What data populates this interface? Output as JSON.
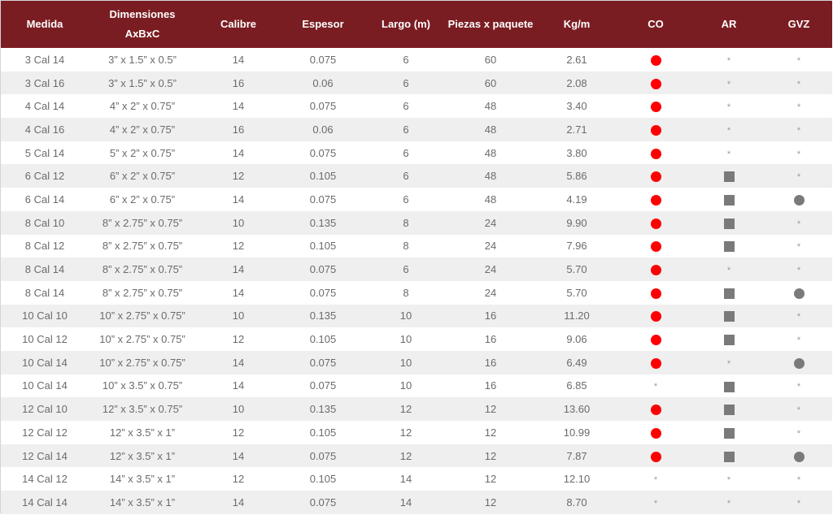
{
  "header": {
    "medida": "Medida",
    "dimensiones_1": "Dimensiones",
    "dimensiones_2": "AxBxC",
    "calibre": "Calibre",
    "espesor": "Espesor",
    "largo": "Largo (m)",
    "piezas": "Piezas x paquete",
    "kgm": "Kg/m",
    "co": "CO",
    "ar": "AR",
    "gvz": "GVZ"
  },
  "colors": {
    "header_bg": "#7a1d22",
    "co_marker": "#ff0000",
    "marker_gray": "#7a7a7a"
  },
  "marker_legend": {
    "circle-red": "red dot",
    "circle-gray": "gray dot",
    "square-gray": "gray square",
    "asterisk": "*"
  },
  "rows": [
    {
      "medida": "3 Cal 14",
      "dim": "3” x 1.5” x 0.5”",
      "calibre": "14",
      "espesor": "0.075",
      "largo": "6",
      "piezas": "60",
      "kgm": "2.61",
      "co": "circle-red",
      "ar": "asterisk",
      "gvz": "asterisk"
    },
    {
      "medida": "3 Cal 16",
      "dim": "3” x 1.5” x 0.5”",
      "calibre": "16",
      "espesor": "0.06",
      "largo": "6",
      "piezas": "60",
      "kgm": "2.08",
      "co": "circle-red",
      "ar": "asterisk",
      "gvz": "asterisk"
    },
    {
      "medida": "4 Cal 14",
      "dim": "4” x 2” x 0.75”",
      "calibre": "14",
      "espesor": "0.075",
      "largo": "6",
      "piezas": "48",
      "kgm": "3.40",
      "co": "circle-red",
      "ar": "asterisk",
      "gvz": "asterisk"
    },
    {
      "medida": "4 Cal 16",
      "dim": "4” x 2” x 0.75”",
      "calibre": "16",
      "espesor": "0.06",
      "largo": "6",
      "piezas": "48",
      "kgm": "2.71",
      "co": "circle-red",
      "ar": "asterisk",
      "gvz": "asterisk"
    },
    {
      "medida": "5 Cal 14",
      "dim": "5” x 2” x 0.75”",
      "calibre": "14",
      "espesor": "0.075",
      "largo": "6",
      "piezas": "48",
      "kgm": "3.80",
      "co": "circle-red",
      "ar": "asterisk",
      "gvz": "asterisk"
    },
    {
      "medida": "6 Cal 12",
      "dim": "6” x 2” x 0.75”",
      "calibre": "12",
      "espesor": "0.105",
      "largo": "6",
      "piezas": "48",
      "kgm": "5.86",
      "co": "circle-red",
      "ar": "square-gray",
      "gvz": "asterisk"
    },
    {
      "medida": "6 Cal 14",
      "dim": "6” x 2” x 0.75”",
      "calibre": "14",
      "espesor": "0.075",
      "largo": "6",
      "piezas": "48",
      "kgm": "4.19",
      "co": "circle-red",
      "ar": "square-gray",
      "gvz": "circle-gray"
    },
    {
      "medida": "8 Cal 10",
      "dim": "8” x 2.75” x 0.75”",
      "calibre": "10",
      "espesor": "0.135",
      "largo": "8",
      "piezas": "24",
      "kgm": "9.90",
      "co": "circle-red",
      "ar": "square-gray",
      "gvz": "asterisk"
    },
    {
      "medida": "8 Cal 12",
      "dim": "8” x 2.75” x 0.75”",
      "calibre": "12",
      "espesor": "0.105",
      "largo": "8",
      "piezas": "24",
      "kgm": "7.96",
      "co": "circle-red",
      "ar": "square-gray",
      "gvz": "asterisk"
    },
    {
      "medida": "8 Cal 14",
      "dim": "8” x 2.75” x 0.75”",
      "calibre": "14",
      "espesor": "0.075",
      "largo": "6",
      "piezas": "24",
      "kgm": "5.70",
      "co": "circle-red",
      "ar": "asterisk",
      "gvz": "asterisk"
    },
    {
      "medida": "8 Cal 14",
      "dim": "8” x 2.75” x 0.75”",
      "calibre": "14",
      "espesor": "0.075",
      "largo": "8",
      "piezas": "24",
      "kgm": "5.70",
      "co": "circle-red",
      "ar": "square-gray",
      "gvz": "circle-gray"
    },
    {
      "medida": "10 Cal 10",
      "dim": "10” x 2.75” x 0.75”",
      "calibre": "10",
      "espesor": "0.135",
      "largo": "10",
      "piezas": "16",
      "kgm": "11.20",
      "co": "circle-red",
      "ar": "square-gray",
      "gvz": "asterisk"
    },
    {
      "medida": "10 Cal 12",
      "dim": "10” x 2.75” x 0.75”",
      "calibre": "12",
      "espesor": "0.105",
      "largo": "10",
      "piezas": "16",
      "kgm": "9.06",
      "co": "circle-red",
      "ar": "square-gray",
      "gvz": "asterisk"
    },
    {
      "medida": "10 Cal 14",
      "dim": "10” x 2.75” x 0.75”",
      "calibre": "14",
      "espesor": "0.075",
      "largo": "10",
      "piezas": "16",
      "kgm": "6.49",
      "co": "circle-red",
      "ar": "asterisk",
      "gvz": "circle-gray"
    },
    {
      "medida": "10 Cal 14",
      "dim": "10” x 3.5” x 0.75”",
      "calibre": "14",
      "espesor": "0.075",
      "largo": "10",
      "piezas": "16",
      "kgm": "6.85",
      "co": "asterisk",
      "ar": "square-gray",
      "gvz": "asterisk"
    },
    {
      "medida": "12 Cal 10",
      "dim": "12” x 3.5” x 0.75”",
      "calibre": "10",
      "espesor": "0.135",
      "largo": "12",
      "piezas": "12",
      "kgm": "13.60",
      "co": "circle-red",
      "ar": "square-gray",
      "gvz": "asterisk"
    },
    {
      "medida": "12 Cal 12",
      "dim": "12” x 3.5” x 1”",
      "calibre": "12",
      "espesor": "0.105",
      "largo": "12",
      "piezas": "12",
      "kgm": "10.99",
      "co": "circle-red",
      "ar": "square-gray",
      "gvz": "asterisk"
    },
    {
      "medida": "12 Cal 14",
      "dim": "12” x 3.5” x 1”",
      "calibre": "14",
      "espesor": "0.075",
      "largo": "12",
      "piezas": "12",
      "kgm": "7.87",
      "co": "circle-red",
      "ar": "square-gray",
      "gvz": "circle-gray"
    },
    {
      "medida": "14 Cal 12",
      "dim": "14” x 3.5” x 1”",
      "calibre": "12",
      "espesor": "0.105",
      "largo": "14",
      "piezas": "12",
      "kgm": "12.10",
      "co": "asterisk",
      "ar": "asterisk",
      "gvz": "asterisk"
    },
    {
      "medida": "14 Cal 14",
      "dim": "14” x 3.5” x 1”",
      "calibre": "14",
      "espesor": "0.075",
      "largo": "14",
      "piezas": "12",
      "kgm": "8.70",
      "co": "asterisk",
      "ar": "asterisk",
      "gvz": "asterisk"
    }
  ]
}
